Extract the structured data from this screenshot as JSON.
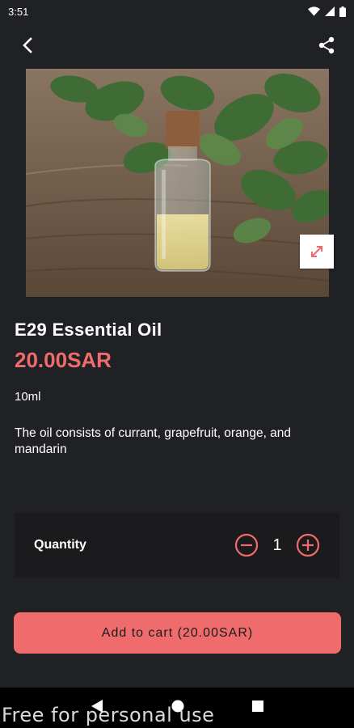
{
  "status_bar": {
    "time": "3:51",
    "icons": [
      "wifi-icon",
      "signal-icon",
      "battery-icon"
    ]
  },
  "app_bar": {
    "back_icon": "back-arrow-icon",
    "share_icon": "share-icon"
  },
  "product": {
    "image_icon": "expand-icon",
    "title": "E29 Essential Oil",
    "price": "20.00SAR",
    "size": "10ml",
    "description": "The oil consists of currant, grapefruit, orange, and mandarin"
  },
  "quantity": {
    "label": "Quantity",
    "value": "1",
    "decrement_icon": "minus-circle-icon",
    "increment_icon": "plus-circle-icon"
  },
  "cart": {
    "button_label": "Add to cart (20.00SAR)"
  },
  "nav_bar": {
    "items": [
      "back-triangle-icon",
      "home-circle-icon",
      "recents-square-icon"
    ]
  },
  "watermark": "Free for personal use",
  "colors": {
    "background": "#202124",
    "accent": "#f06b6b",
    "card": "#1b1b1d"
  }
}
